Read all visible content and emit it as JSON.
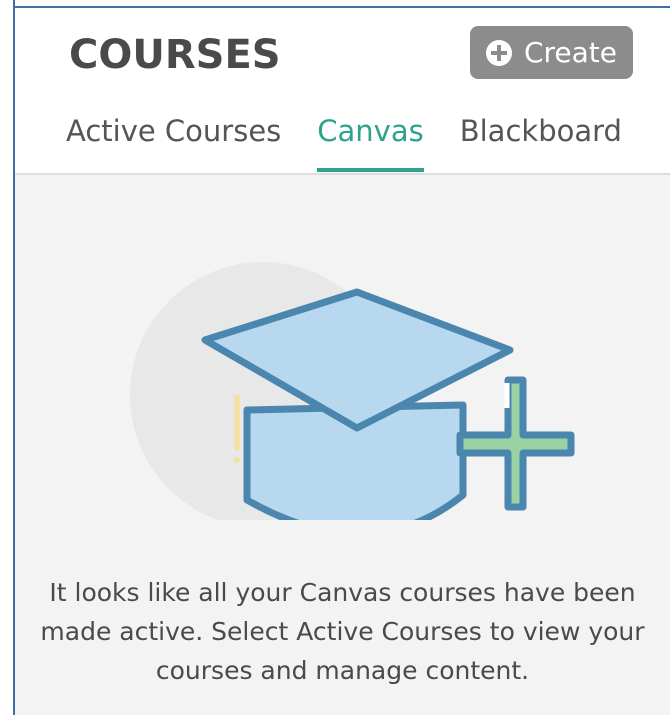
{
  "header": {
    "title": "COURSES",
    "create_label": "Create"
  },
  "tabs": [
    {
      "label": "Active Courses",
      "active": false
    },
    {
      "label": "Canvas",
      "active": true
    },
    {
      "label": "Blackboard",
      "active": false
    }
  ],
  "empty_state": {
    "message": "It looks like all your Canvas courses have been made active. Select Active Courses to view your courses and manage content."
  },
  "colors": {
    "accent": "#2ea28c",
    "button_bg": "#8c8c8c",
    "cap_fill": "#b7d8ef",
    "cap_stroke": "#4a86ad",
    "plus_fill": "#99d3a3",
    "content_bg": "#f3f3f3"
  }
}
